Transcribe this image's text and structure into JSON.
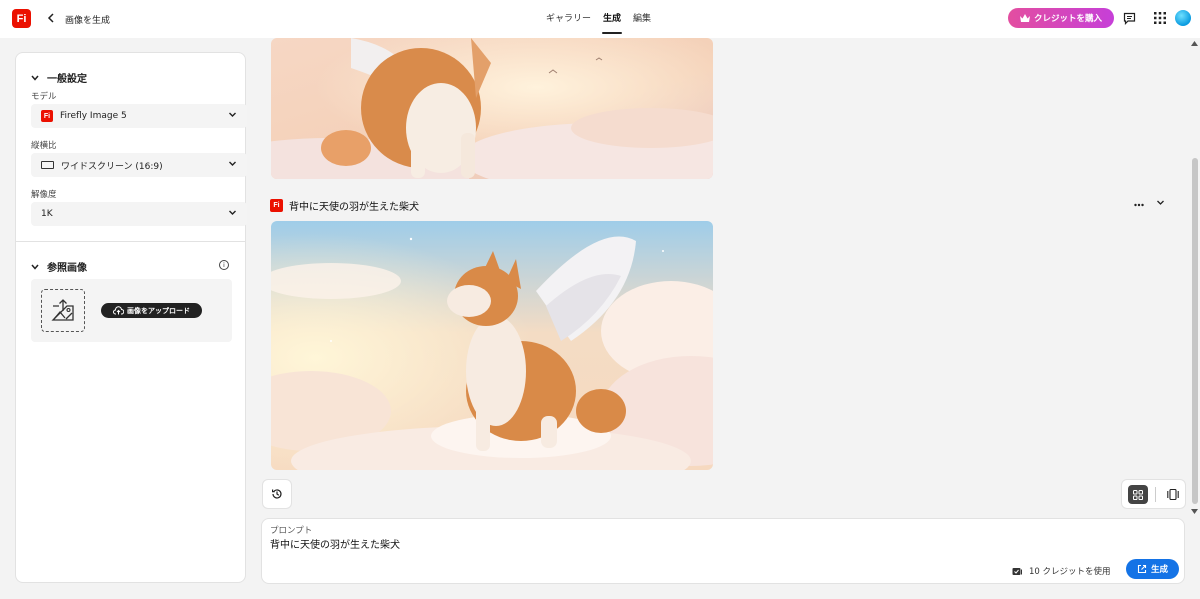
{
  "app": {
    "logo_text": "Fi",
    "page_title": "画像を生成"
  },
  "header": {
    "tabs": [
      {
        "label": "ギャラリー",
        "active": false
      },
      {
        "label": "生成",
        "active": true
      },
      {
        "label": "編集",
        "active": false
      }
    ],
    "buy_credits_label": "クレジットを購入",
    "accent_gradient": [
      "#e34ea0",
      "#c63fd8"
    ]
  },
  "general_settings": {
    "title": "一般設定",
    "model_label": "モデル",
    "model_value": "Firefly Image 5",
    "aspect_label": "縦横比",
    "aspect_value": "ワイドスクリーン (16:9)",
    "resolution_label": "解像度",
    "resolution_value": "1K"
  },
  "reference_image": {
    "title": "参照画像",
    "upload_label": "画像をアップロード"
  },
  "results": {
    "prompt_title": "背中に天使の羽が生えた柴犬"
  },
  "prompt_panel": {
    "label": "プロンプト",
    "value": "背中に天使の羽が生えた柴犬",
    "credit_text": "10 クレジットを使用",
    "generate_label": "生成",
    "generate_color": "#1473e6"
  },
  "colors": {
    "brand_red": "#eb1000"
  }
}
